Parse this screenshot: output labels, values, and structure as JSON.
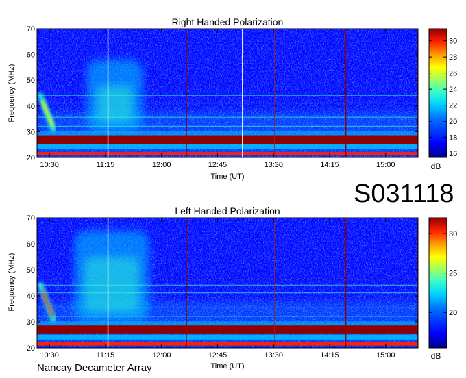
{
  "observation_id": "S031118",
  "footer": "Nancay Decameter Array",
  "colors": {
    "background": "#ffffff",
    "colormap": [
      "#000090",
      "#0000ff",
      "#0060ff",
      "#00c0ff",
      "#30ffd0",
      "#a0ff60",
      "#ffff00",
      "#ff9000",
      "#ff2000",
      "#900000"
    ],
    "vertical_burst_lines": "#8b0000",
    "white_gap_lines": "#ffffff"
  },
  "chart_data": [
    {
      "type": "heatmap",
      "title": "Right Handed Polarization",
      "xlabel": "Time (UT)",
      "ylabel": "Frequency (MHz)",
      "x_ticks": [
        "10:30",
        "11:15",
        "12:00",
        "12:45",
        "13:30",
        "14:15",
        "15:00"
      ],
      "x_tick_minutes": [
        630,
        675,
        720,
        765,
        810,
        855,
        900
      ],
      "xlim_minutes": [
        620,
        926
      ],
      "ylim": [
        20,
        70
      ],
      "y_ticks": [
        20,
        30,
        40,
        50,
        60,
        70
      ],
      "colorbar": {
        "label": "dB",
        "range": [
          15.5,
          31.5
        ],
        "ticks": [
          16,
          18,
          20,
          22,
          24,
          26,
          28,
          30
        ]
      },
      "features": {
        "rfi_bands_mhz": [
          21.5,
          26.5,
          27.5
        ],
        "drifting_burst": {
          "start_minute": 622,
          "end_minute": 634,
          "freq_high": 45,
          "freq_low": 30
        },
        "diffuse_emission": {
          "start_minute": 660,
          "end_minute": 705,
          "freq_low": 30,
          "freq_high": 58
        },
        "gap_lines_minutes": [
          677,
          785,
          811
        ],
        "dark_lines_minutes": [
          740,
          811,
          868,
          926
        ]
      }
    },
    {
      "type": "heatmap",
      "title": "Left Handed Polarization",
      "xlabel": "Time (UT)",
      "ylabel": "Frequency (MHz)",
      "x_ticks": [
        "10:30",
        "11:15",
        "12:00",
        "12:45",
        "13:30",
        "14:15",
        "15:00"
      ],
      "x_tick_minutes": [
        630,
        675,
        720,
        765,
        810,
        855,
        900
      ],
      "xlim_minutes": [
        620,
        926
      ],
      "ylim": [
        20,
        70
      ],
      "y_ticks": [
        20,
        30,
        40,
        50,
        60,
        70
      ],
      "colorbar": {
        "label": "dB",
        "range": [
          15.5,
          32
        ],
        "ticks": [
          20,
          25,
          30
        ]
      },
      "features": {
        "rfi_bands_mhz": [
          21.5,
          26.5,
          27.5
        ],
        "drifting_burst": {
          "start_minute": 622,
          "end_minute": 634,
          "freq_high": 45,
          "freq_low": 30
        },
        "diffuse_emission": {
          "start_minute": 650,
          "end_minute": 710,
          "freq_low": 30,
          "freq_high": 65
        },
        "gap_lines_minutes": [
          677,
          811
        ],
        "dark_lines_minutes": [
          740,
          811,
          868,
          926
        ]
      }
    }
  ]
}
